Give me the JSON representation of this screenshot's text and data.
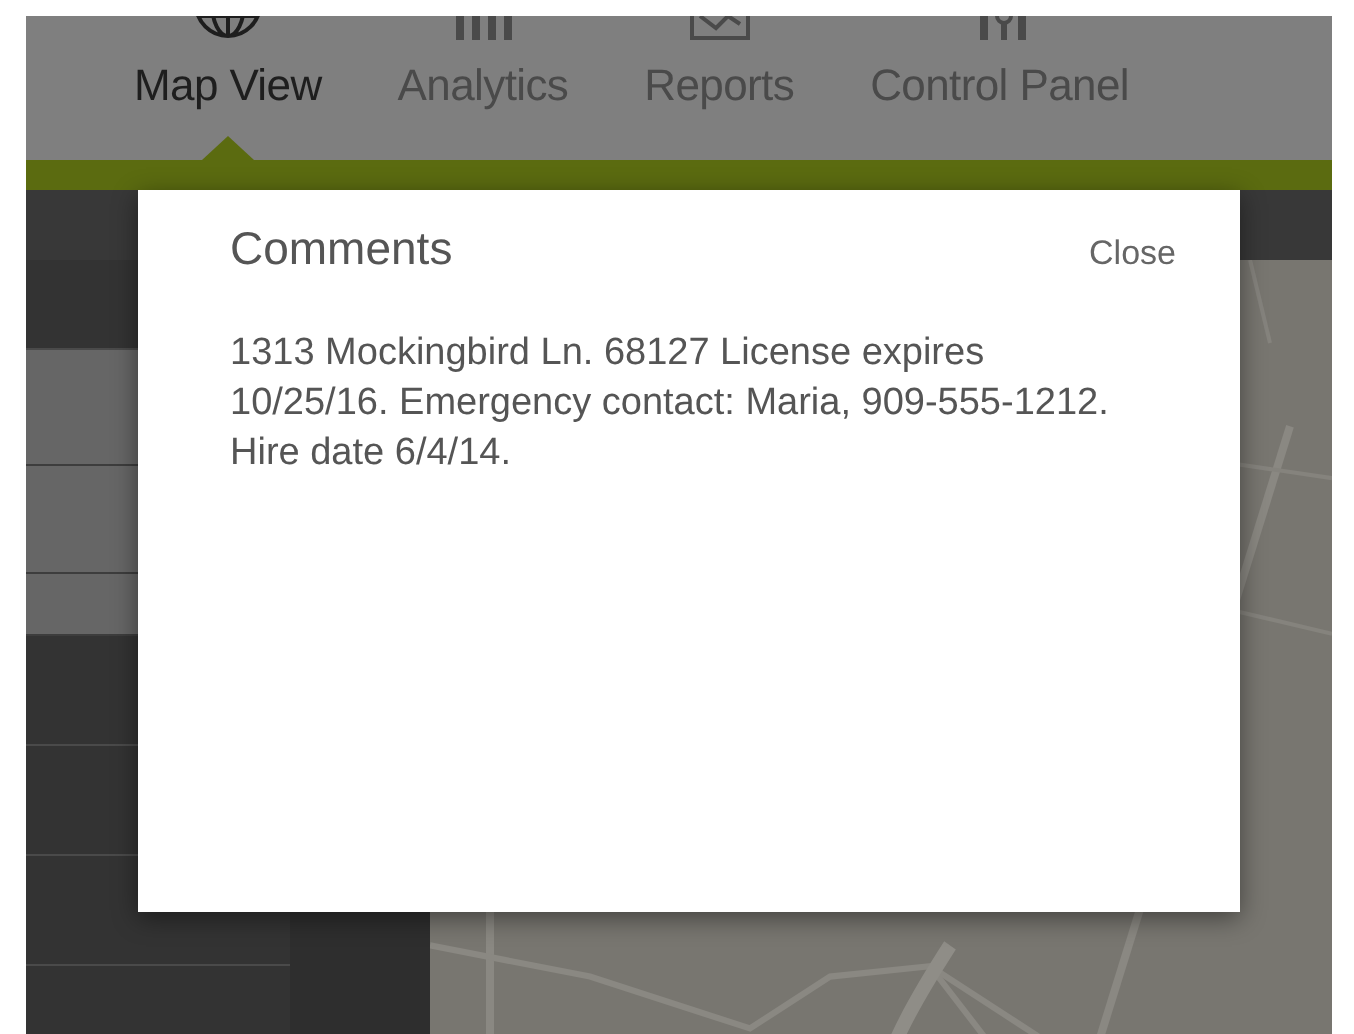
{
  "nav": {
    "tabs": [
      {
        "label": "Map View",
        "kind": "globe",
        "selected": true
      },
      {
        "label": "Analytics",
        "kind": "bars",
        "selected": false
      },
      {
        "label": "Reports",
        "kind": "tray",
        "selected": false
      },
      {
        "label": "Control Panel",
        "kind": "sliders",
        "selected": false
      }
    ]
  },
  "sidebar": {
    "rows": [
      {
        "kind": "dark"
      },
      {
        "kind": "light"
      },
      {
        "kind": "light"
      },
      {
        "kind": "light"
      },
      {
        "kind": "dark"
      },
      {
        "kind": "dark"
      },
      {
        "kind": "dark"
      },
      {
        "kind": "dark"
      }
    ]
  },
  "dialog": {
    "title": "Comments",
    "close": "Close",
    "body": "1313 Mockingbird Ln. 68127 License expires 10/25/16. Emergency contact: Maria, 909-555-1212. Hire date 6/4/14."
  }
}
